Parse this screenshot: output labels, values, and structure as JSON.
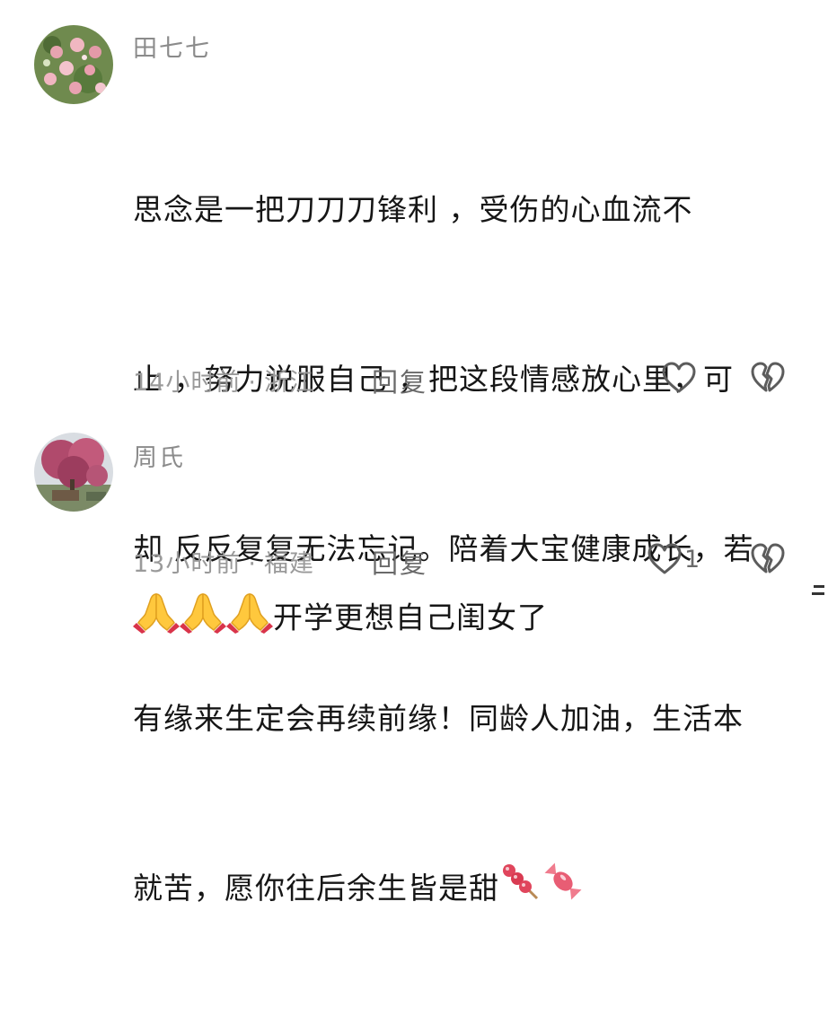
{
  "comments": [
    {
      "username": "田七七",
      "lines": [
        "思念是一把刀刀刀锋利 ，受伤的心血流不",
        "止 ，努力说服自己 ，把这段情感放心里，可",
        "却 反反复复无法忘记。陪着大宝健康成长，若",
        "有缘来生定会再续前缘！同龄人加油，生活本",
        "就苦，愿你往后余生皆是甜"
      ],
      "emojis": [
        "tanghulu-emoji",
        "candy-emoji"
      ],
      "time": "14小时前",
      "dot": "·",
      "location": "浙江",
      "reply": "回复",
      "like_icon": "heart-outline-icon",
      "dislike_icon": "broken-heart-icon"
    },
    {
      "username": "周氏",
      "emojis": [
        "praying-hands-emoji",
        "praying-hands-emoji",
        "praying-hands-emoji"
      ],
      "text": "开学更想自己闺女了",
      "time": "13小时前",
      "dot": "·",
      "location": "福建",
      "reply": "回复",
      "like_count": "1",
      "like_icon": "heart-outline-icon",
      "dislike_icon": "broken-heart-icon"
    }
  ],
  "colors": {
    "text": "#161616",
    "username": "#8b8b8b",
    "meta": "#9a9a9a",
    "icon": "#6a6a6a"
  }
}
